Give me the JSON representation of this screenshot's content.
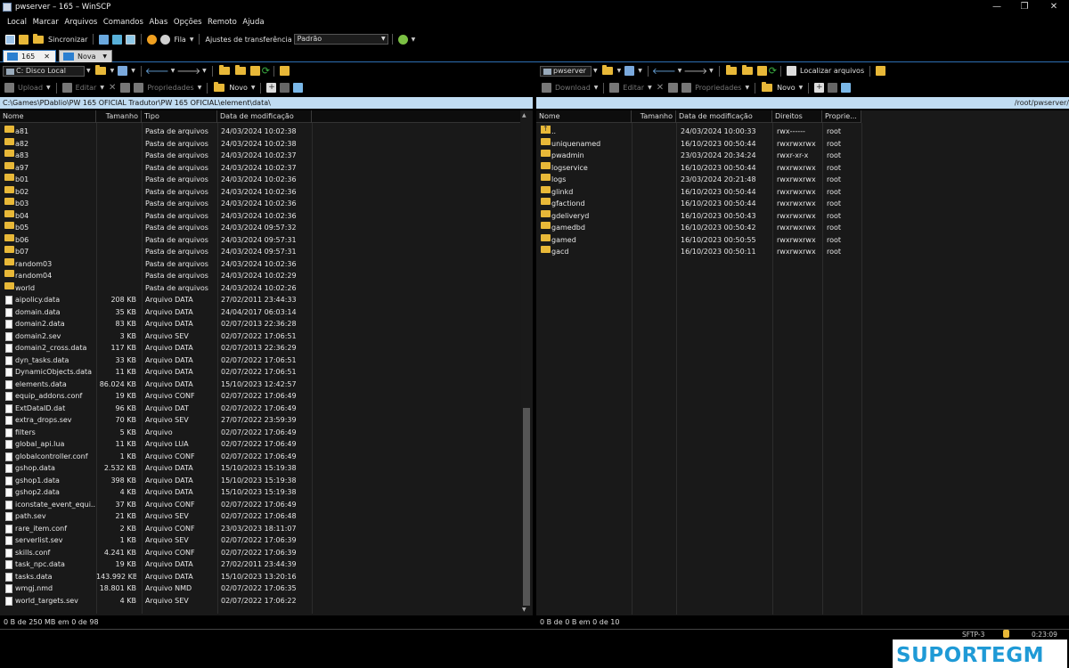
{
  "window": {
    "title": "pwserver – 165 – WinSCP"
  },
  "menu": [
    "Local",
    "Marcar",
    "Arquivos",
    "Comandos",
    "Abas",
    "Opções",
    "Remoto",
    "Ajuda"
  ],
  "toolbar": {
    "sync_label": "Sincronizar",
    "queue_label": "Fila",
    "transfer_settings_label": "Ajustes de transferência",
    "transfer_settings_value": "Padrão"
  },
  "tabs": [
    {
      "label": "165"
    },
    {
      "label": "Nova Aba"
    }
  ],
  "left": {
    "drive_label": "C: Disco Local",
    "actions": {
      "upload": "Upload",
      "edit": "Editar",
      "properties": "Propriedades",
      "new": "Novo"
    },
    "path": "C:\\Games\\PDablio\\PW 165 OFICIAL Tradutor\\PW 165 OFICIAL\\element\\data\\",
    "columns": [
      "Nome",
      "Tamanho",
      "Tipo",
      "Data de modificação"
    ],
    "rows": [
      {
        "icon": "folder",
        "name": "a81",
        "size": "",
        "type": "Pasta de arquivos",
        "date": "24/03/2024 10:02:38"
      },
      {
        "icon": "folder",
        "name": "a82",
        "size": "",
        "type": "Pasta de arquivos",
        "date": "24/03/2024 10:02:38"
      },
      {
        "icon": "folder",
        "name": "a83",
        "size": "",
        "type": "Pasta de arquivos",
        "date": "24/03/2024 10:02:37"
      },
      {
        "icon": "folder",
        "name": "a97",
        "size": "",
        "type": "Pasta de arquivos",
        "date": "24/03/2024 10:02:37"
      },
      {
        "icon": "folder",
        "name": "b01",
        "size": "",
        "type": "Pasta de arquivos",
        "date": "24/03/2024 10:02:36"
      },
      {
        "icon": "folder",
        "name": "b02",
        "size": "",
        "type": "Pasta de arquivos",
        "date": "24/03/2024 10:02:36"
      },
      {
        "icon": "folder",
        "name": "b03",
        "size": "",
        "type": "Pasta de arquivos",
        "date": "24/03/2024 10:02:36"
      },
      {
        "icon": "folder",
        "name": "b04",
        "size": "",
        "type": "Pasta de arquivos",
        "date": "24/03/2024 10:02:36"
      },
      {
        "icon": "folder",
        "name": "b05",
        "size": "",
        "type": "Pasta de arquivos",
        "date": "24/03/2024 09:57:32"
      },
      {
        "icon": "folder",
        "name": "b06",
        "size": "",
        "type": "Pasta de arquivos",
        "date": "24/03/2024 09:57:31"
      },
      {
        "icon": "folder",
        "name": "b07",
        "size": "",
        "type": "Pasta de arquivos",
        "date": "24/03/2024 09:57:31"
      },
      {
        "icon": "folder",
        "name": "random03",
        "size": "",
        "type": "Pasta de arquivos",
        "date": "24/03/2024 10:02:36"
      },
      {
        "icon": "folder",
        "name": "random04",
        "size": "",
        "type": "Pasta de arquivos",
        "date": "24/03/2024 10:02:29"
      },
      {
        "icon": "folder",
        "name": "world",
        "size": "",
        "type": "Pasta de arquivos",
        "date": "24/03/2024 10:02:26"
      },
      {
        "icon": "file",
        "name": "aipolicy.data",
        "size": "208 KB",
        "type": "Arquivo DATA",
        "date": "27/02/2011 23:44:33"
      },
      {
        "icon": "file",
        "name": "domain.data",
        "size": "35 KB",
        "type": "Arquivo DATA",
        "date": "24/04/2017 06:03:14"
      },
      {
        "icon": "file",
        "name": "domain2.data",
        "size": "83 KB",
        "type": "Arquivo DATA",
        "date": "02/07/2013 22:36:28"
      },
      {
        "icon": "file",
        "name": "domain2.sev",
        "size": "3 KB",
        "type": "Arquivo SEV",
        "date": "02/07/2022 17:06:51"
      },
      {
        "icon": "file",
        "name": "domain2_cross.data",
        "size": "117 KB",
        "type": "Arquivo DATA",
        "date": "02/07/2013 22:36:29"
      },
      {
        "icon": "file",
        "name": "dyn_tasks.data",
        "size": "33 KB",
        "type": "Arquivo DATA",
        "date": "02/07/2022 17:06:51"
      },
      {
        "icon": "file",
        "name": "DynamicObjects.data",
        "size": "11 KB",
        "type": "Arquivo DATA",
        "date": "02/07/2022 17:06:51"
      },
      {
        "icon": "file",
        "name": "elements.data",
        "size": "86.024 KB",
        "type": "Arquivo DATA",
        "date": "15/10/2023 12:42:57"
      },
      {
        "icon": "file",
        "name": "equip_addons.conf",
        "size": "19 KB",
        "type": "Arquivo CONF",
        "date": "02/07/2022 17:06:49"
      },
      {
        "icon": "file",
        "name": "ExtDataID.dat",
        "size": "96 KB",
        "type": "Arquivo DAT",
        "date": "02/07/2022 17:06:49"
      },
      {
        "icon": "file",
        "name": "extra_drops.sev",
        "size": "70 KB",
        "type": "Arquivo SEV",
        "date": "27/07/2022 23:59:39"
      },
      {
        "icon": "file",
        "name": "filters",
        "size": "5 KB",
        "type": "Arquivo",
        "date": "02/07/2022 17:06:49"
      },
      {
        "icon": "file",
        "name": "global_api.lua",
        "size": "11 KB",
        "type": "Arquivo LUA",
        "date": "02/07/2022 17:06:49"
      },
      {
        "icon": "file",
        "name": "globalcontroller.conf",
        "size": "1 KB",
        "type": "Arquivo CONF",
        "date": "02/07/2022 17:06:49"
      },
      {
        "icon": "file",
        "name": "gshop.data",
        "size": "2.532 KB",
        "type": "Arquivo DATA",
        "date": "15/10/2023 15:19:38"
      },
      {
        "icon": "file",
        "name": "gshop1.data",
        "size": "398 KB",
        "type": "Arquivo DATA",
        "date": "15/10/2023 15:19:38"
      },
      {
        "icon": "file",
        "name": "gshop2.data",
        "size": "4 KB",
        "type": "Arquivo DATA",
        "date": "15/10/2023 15:19:38"
      },
      {
        "icon": "file",
        "name": "iconstate_event_equi...",
        "size": "37 KB",
        "type": "Arquivo CONF",
        "date": "02/07/2022 17:06:49"
      },
      {
        "icon": "file",
        "name": "path.sev",
        "size": "21 KB",
        "type": "Arquivo SEV",
        "date": "02/07/2022 17:06:48"
      },
      {
        "icon": "file",
        "name": "rare_item.conf",
        "size": "2 KB",
        "type": "Arquivo CONF",
        "date": "23/03/2023 18:11:07"
      },
      {
        "icon": "file",
        "name": "serverlist.sev",
        "size": "1 KB",
        "type": "Arquivo SEV",
        "date": "02/07/2022 17:06:39"
      },
      {
        "icon": "file",
        "name": "skills.conf",
        "size": "4.241 KB",
        "type": "Arquivo CONF",
        "date": "02/07/2022 17:06:39"
      },
      {
        "icon": "file",
        "name": "task_npc.data",
        "size": "19 KB",
        "type": "Arquivo DATA",
        "date": "27/02/2011 23:44:39"
      },
      {
        "icon": "file",
        "name": "tasks.data",
        "size": "143.992 KB",
        "type": "Arquivo DATA",
        "date": "15/10/2023 13:20:16"
      },
      {
        "icon": "file",
        "name": "wmgj.nmd",
        "size": "18.801 KB",
        "type": "Arquivo NMD",
        "date": "02/07/2022 17:06:35"
      },
      {
        "icon": "file",
        "name": "world_targets.sev",
        "size": "4 KB",
        "type": "Arquivo SEV",
        "date": "02/07/2022 17:06:22"
      }
    ],
    "status": "0 B de 250 MB em 0 de 98"
  },
  "right": {
    "session_label": "pwserver",
    "find_files_label": "Localizar arquivos",
    "actions": {
      "download": "Download",
      "edit": "Editar",
      "properties": "Propriedades",
      "new": "Novo"
    },
    "path": "/root/pwserver/",
    "columns": [
      "Nome",
      "Tamanho",
      "Data de modificação",
      "Direitos",
      "Proprie..."
    ],
    "rows": [
      {
        "icon": "up",
        "name": "..",
        "size": "",
        "date": "24/03/2024 10:00:33",
        "rights": "rwx------",
        "owner": "root"
      },
      {
        "icon": "folder",
        "name": "uniquenamed",
        "size": "",
        "date": "16/10/2023 00:50:44",
        "rights": "rwxrwxrwx",
        "owner": "root"
      },
      {
        "icon": "folder",
        "name": "pwadmin",
        "size": "",
        "date": "23/03/2024 20:34:24",
        "rights": "rwxr-xr-x",
        "owner": "root"
      },
      {
        "icon": "folder",
        "name": "logservice",
        "size": "",
        "date": "16/10/2023 00:50:44",
        "rights": "rwxrwxrwx",
        "owner": "root"
      },
      {
        "icon": "folder",
        "name": "logs",
        "size": "",
        "date": "23/03/2024 20:21:48",
        "rights": "rwxrwxrwx",
        "owner": "root"
      },
      {
        "icon": "folder",
        "name": "glinkd",
        "size": "",
        "date": "16/10/2023 00:50:44",
        "rights": "rwxrwxrwx",
        "owner": "root"
      },
      {
        "icon": "folder",
        "name": "gfactiond",
        "size": "",
        "date": "16/10/2023 00:50:44",
        "rights": "rwxrwxrwx",
        "owner": "root"
      },
      {
        "icon": "folder",
        "name": "gdeliveryd",
        "size": "",
        "date": "16/10/2023 00:50:43",
        "rights": "rwxrwxrwx",
        "owner": "root"
      },
      {
        "icon": "folder",
        "name": "gamedbd",
        "size": "",
        "date": "16/10/2023 00:50:42",
        "rights": "rwxrwxrwx",
        "owner": "root"
      },
      {
        "icon": "folder",
        "name": "gamed",
        "size": "",
        "date": "16/10/2023 00:50:55",
        "rights": "rwxrwxrwx",
        "owner": "root"
      },
      {
        "icon": "folder",
        "name": "gacd",
        "size": "",
        "date": "16/10/2023 00:50:11",
        "rights": "rwxrwxrwx",
        "owner": "root"
      }
    ],
    "status": "0 B de 0 B em 0 de 10"
  },
  "statusbar": {
    "protocol": "SFTP-3",
    "time": "0:23:09"
  },
  "watermark": {
    "text": "SUPORTEGM"
  },
  "colors": {
    "background": "#000000",
    "path_bar": "#c0dcf2",
    "folder": "#e8b838",
    "tab_accent": "#2d6fb3",
    "watermark": "#1f9ad6"
  }
}
